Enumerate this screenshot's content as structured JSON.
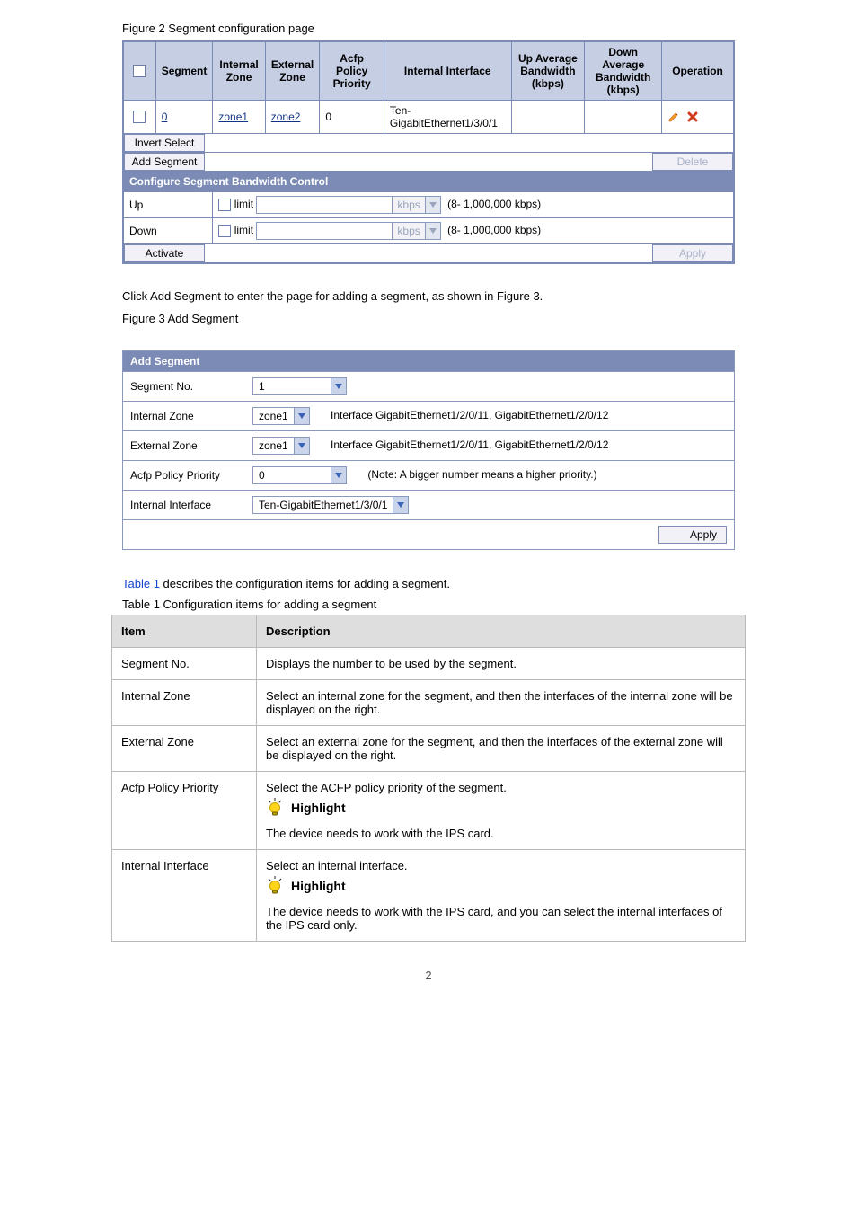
{
  "fig1": {
    "caption": "Figure 2 Segment configuration page",
    "headers": {
      "seg": "Segment",
      "izone": "Internal Zone",
      "ezone": "External Zone",
      "acfp": "Acfp Policy Priority",
      "iif": "Internal Interface",
      "upbw": "Up Average Bandwidth (kbps)",
      "dnbw": "Down Average Bandwidth (kbps)",
      "op": "Operation"
    },
    "row": {
      "seg": "0",
      "izone": "zone1",
      "ezone": "zone2",
      "acfp": "0",
      "iif": "Ten-GigabitEthernet1/3/0/1",
      "upbw": "",
      "dnbw": ""
    },
    "buttons": {
      "invert": "Invert Select",
      "add": "Add Segment",
      "delete": "Delete",
      "activate": "Activate",
      "apply": "Apply"
    },
    "cfgHeader": "Configure Segment Bandwidth Control",
    "up": "Up",
    "down": "Down",
    "limit": "limit",
    "kbps": "kbps",
    "range": "(8- 1,000,000 kbps)"
  },
  "fig2Lead": "Click Add Segment to enter the page for adding a segment, as shown in Figure 3.",
  "fig2": {
    "caption": "Figure 3 Add Segment",
    "header": "Add Segment",
    "rows": {
      "segno_l": "Segment No.",
      "segno_v": "1",
      "iz_l": "Internal Zone",
      "iz_v": "zone1",
      "iz_note": "Interface GigabitEthernet1/2/0/11, GigabitEthernet1/2/0/12",
      "ez_l": "External Zone",
      "ez_v": "zone1",
      "ez_note": "Interface GigabitEthernet1/2/0/11, GigabitEthernet1/2/0/12",
      "pp_l": "Acfp Policy Priority",
      "pp_v": "0",
      "pp_note": "(Note: A bigger number means a higher priority.)",
      "ii_l": "Internal Interface",
      "ii_v": "Ten-GigabitEthernet1/3/0/1"
    },
    "apply": "Apply"
  },
  "desc": {
    "introPrefix": "",
    "tableLink": "Table 1",
    "introSuffix": " describes the configuration items for adding a segment.",
    "caption": "Table 1 Configuration items for adding a segment",
    "th_item": "Item",
    "th_desc": "Description",
    "items": {
      "segno": {
        "l": "Segment No.",
        "d": "Displays the number to be used by the segment."
      },
      "izone": {
        "l": "Internal Zone",
        "d": "Select an internal zone for the segment, and then the interfaces of the internal zone will be displayed on the right."
      },
      "ezone": {
        "l": "External Zone",
        "d": "Select an external zone for the segment, and then the interfaces of the external zone will be displayed on the right."
      },
      "policy": {
        "l": "Acfp Policy Priority",
        "d1": "Select the ACFP policy priority of the segment.",
        "hl": "Highlight",
        "d2": "The device needs to work with the IPS card."
      },
      "iif": {
        "l": "Internal Interface",
        "d1": "Select an internal interface.",
        "hl": "Highlight",
        "d2": "The device needs to work with the IPS card, and you can select the internal interfaces of the IPS card only."
      }
    }
  },
  "pageNo": "2"
}
